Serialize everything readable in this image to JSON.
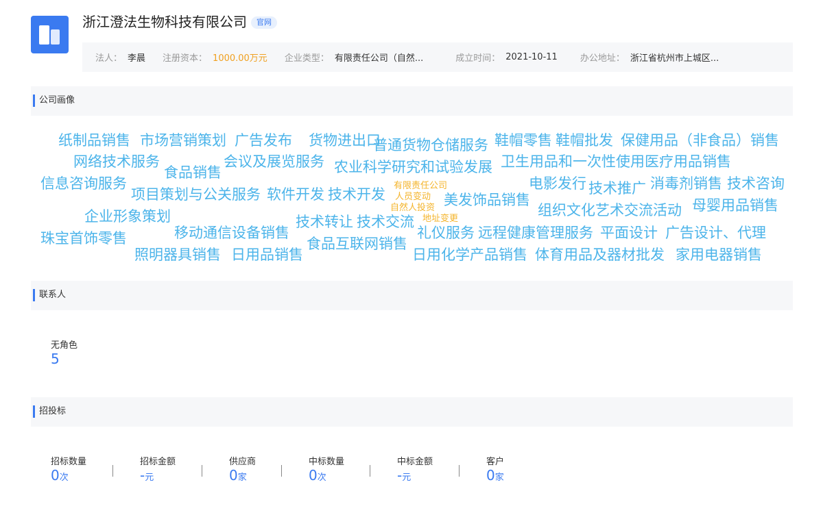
{
  "company": {
    "name": "浙江澄法生物科技有限公司",
    "official_badge": "官网",
    "logo_icon": "building-icon",
    "info": [
      {
        "label": "法人：",
        "value": "李晨"
      },
      {
        "label": "注册资本：",
        "value": "1000.00万元",
        "highlight_color": "#f0a020"
      },
      {
        "label": "企业类型：",
        "value": "有限责任公司（自然..."
      },
      {
        "label": "成立时间：",
        "value": "2021-10-11"
      },
      {
        "label": "办公地址：",
        "value": "浙江省杭州市上城区..."
      }
    ]
  },
  "sections": {
    "portrait": "公司画像",
    "contacts": "联系人",
    "bidding": "招投标"
  },
  "word_cloud": {
    "primary_color": "#4cb4ea",
    "secondary_color": "#f4b42c",
    "words": [
      "纸制品销售",
      "市场营销策划",
      "广告发布",
      "货物进出口",
      "普通货物仓储服务",
      "鞋帽零售",
      "鞋帽批发",
      "保健用品（非食品）销售",
      "网络技术服务",
      "食品销售",
      "会议及展览服务",
      "农业科学研究和试验发展",
      "卫生用品和一次性使用医疗用品销售",
      "信息咨询服务",
      "项目策划与公关服务",
      "软件开发",
      "技术开发",
      "电影发行",
      "技术推广",
      "消毒剂销售",
      "技术咨询",
      "美发饰品销售",
      "组织文化艺术交流活动",
      "母婴用品销售",
      "企业形象策划",
      "技术转让",
      "技术交流",
      "珠宝首饰零售",
      "移动通信设备销售",
      "礼仪服务",
      "远程健康管理服务",
      "平面设计",
      "广告设计、代理",
      "食品互联网销售",
      "照明器具销售",
      "日用品销售",
      "日用化学产品销售",
      "体育用品及器材批发",
      "家用电器销售",
      "有限责任公司",
      "人员变动",
      "自然人投资",
      "地址变更"
    ]
  },
  "contacts": {
    "label": "无角色",
    "count": "5"
  },
  "bidding": {
    "stats": [
      {
        "label": "招标数量",
        "value": "0",
        "unit": "次"
      },
      {
        "label": "招标金额",
        "value": "-",
        "unit": "元"
      },
      {
        "label": "供应商",
        "value": "0",
        "unit": "家"
      },
      {
        "label": "中标数量",
        "value": "0",
        "unit": "次"
      },
      {
        "label": "中标金额",
        "value": "-",
        "unit": "元"
      },
      {
        "label": "客户",
        "value": "0",
        "unit": "家"
      }
    ]
  }
}
